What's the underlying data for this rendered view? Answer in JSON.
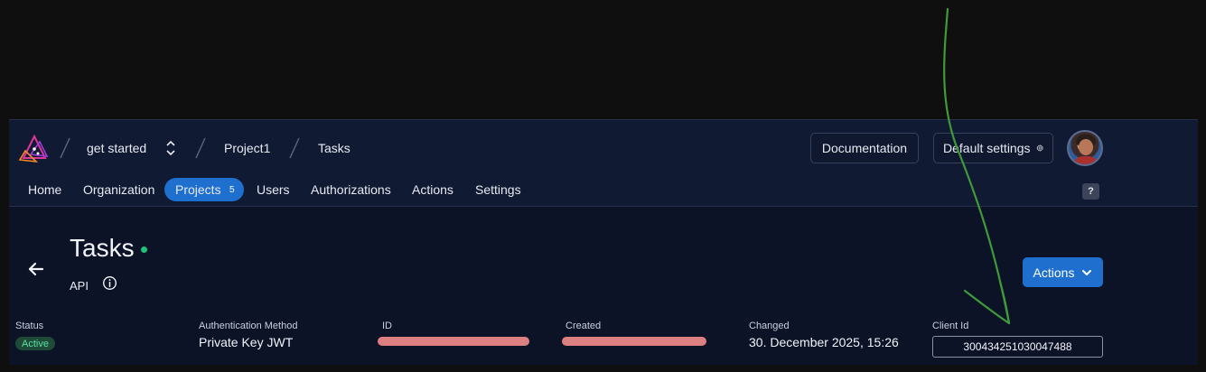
{
  "breadcrumb": {
    "org": "get started",
    "project": "Project1",
    "app": "Tasks"
  },
  "header": {
    "documentation_label": "Documentation",
    "default_settings_label": "Default settings"
  },
  "nav": {
    "items": [
      {
        "label": "Home"
      },
      {
        "label": "Organization"
      },
      {
        "label": "Projects",
        "badge": "5",
        "active": true
      },
      {
        "label": "Users"
      },
      {
        "label": "Authorizations"
      },
      {
        "label": "Actions"
      },
      {
        "label": "Settings"
      }
    ],
    "help_label": "?"
  },
  "page": {
    "title": "Tasks",
    "subtitle": "API",
    "status_color": "#1ec27a",
    "actions_label": "Actions"
  },
  "details": {
    "status_label": "Status",
    "status_value": "Active",
    "auth_method_label": "Authentication Method",
    "auth_method_value": "Private Key JWT",
    "id_label": "ID",
    "created_label": "Created",
    "changed_label": "Changed",
    "changed_value": "30. December 2025, 15:26",
    "client_id_label": "Client Id",
    "client_id_value": "300434251030047488"
  },
  "colors": {
    "accent": "#1f6fcf",
    "background": "#0c1326",
    "annotation": "#3f9a3a",
    "redaction": "#f08a8a"
  }
}
